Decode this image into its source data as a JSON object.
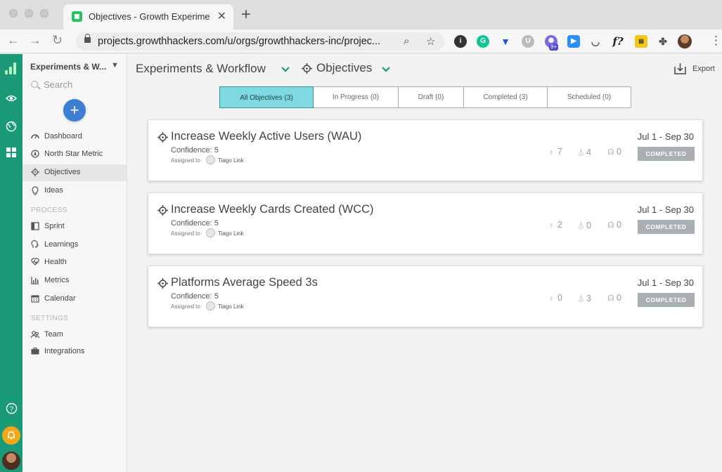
{
  "browser": {
    "tab_title": "Objectives - Growth Experimen",
    "url": "projects.growthhackers.com/u/orgs/growthhackers-inc/projec...",
    "extension_badge": "9+"
  },
  "rail": {
    "icons": [
      "growthhackers-logo",
      "eye-icon",
      "globe-icon",
      "grid-icon",
      "help-icon",
      "bell-icon",
      "user-avatar"
    ]
  },
  "sidebar": {
    "workspace": "Experiments & W...",
    "search_placeholder": "Search",
    "add_label": "+",
    "items": [
      {
        "label": "Dashboard",
        "icon": "dashboard-icon"
      },
      {
        "label": "North Star Metric",
        "icon": "north-star-icon"
      },
      {
        "label": "Objectives",
        "icon": "target-icon",
        "active": true
      },
      {
        "label": "Ideas",
        "icon": "lightbulb-icon"
      }
    ],
    "process_label": "PROCESS",
    "process_items": [
      {
        "label": "Sprint",
        "icon": "sprint-icon"
      },
      {
        "label": "Learnings",
        "icon": "brain-icon"
      },
      {
        "label": "Health",
        "icon": "heart-icon"
      },
      {
        "label": "Metrics",
        "icon": "bar-chart-icon"
      },
      {
        "label": "Calendar",
        "icon": "calendar-icon"
      }
    ],
    "settings_label": "SETTINGS",
    "settings_items": [
      {
        "label": "Team",
        "icon": "team-icon"
      },
      {
        "label": "Integrations",
        "icon": "briefcase-icon"
      }
    ]
  },
  "header": {
    "project": "Experiments & Workflow",
    "section": "Objectives",
    "export_label": "Export"
  },
  "filters": [
    {
      "label": "All Objectives (3)",
      "active": true
    },
    {
      "label": "In Progress (0)"
    },
    {
      "label": "Draft (0)"
    },
    {
      "label": "Completed (3)"
    },
    {
      "label": "Scheduled (0)"
    }
  ],
  "objectives": [
    {
      "title": "Increase Weekly Active Users (WAU)",
      "confidence": "Confidence: 5",
      "assigned_to_label": "Assigned to",
      "assignee": "Tiago Link",
      "dates": "Jul 1 - Sep 30",
      "ideas": "7",
      "experiments": "4",
      "learnings": "0",
      "status": "COMPLETED"
    },
    {
      "title": "Increase Weekly Cards Created (WCC)",
      "confidence": "Confidence: 5",
      "assigned_to_label": "Assigned to",
      "assignee": "Tiago Link",
      "dates": "Jul 1 - Sep 30",
      "ideas": "2",
      "experiments": "0",
      "learnings": "0",
      "status": "COMPLETED"
    },
    {
      "title": "Platforms Average Speed 3s",
      "confidence": "Confidence: 5",
      "assigned_to_label": "Assigned to",
      "assignee": "Tiago Link",
      "dates": "Jul 1 - Sep 30",
      "ideas": "0",
      "experiments": "3",
      "learnings": "0",
      "status": "COMPLETED"
    }
  ],
  "colors": {
    "accent": "#1a9a76",
    "filter_active": "#7fd9e0",
    "add_button": "#3c7fd2",
    "status_badge": "#a9b0b3"
  }
}
